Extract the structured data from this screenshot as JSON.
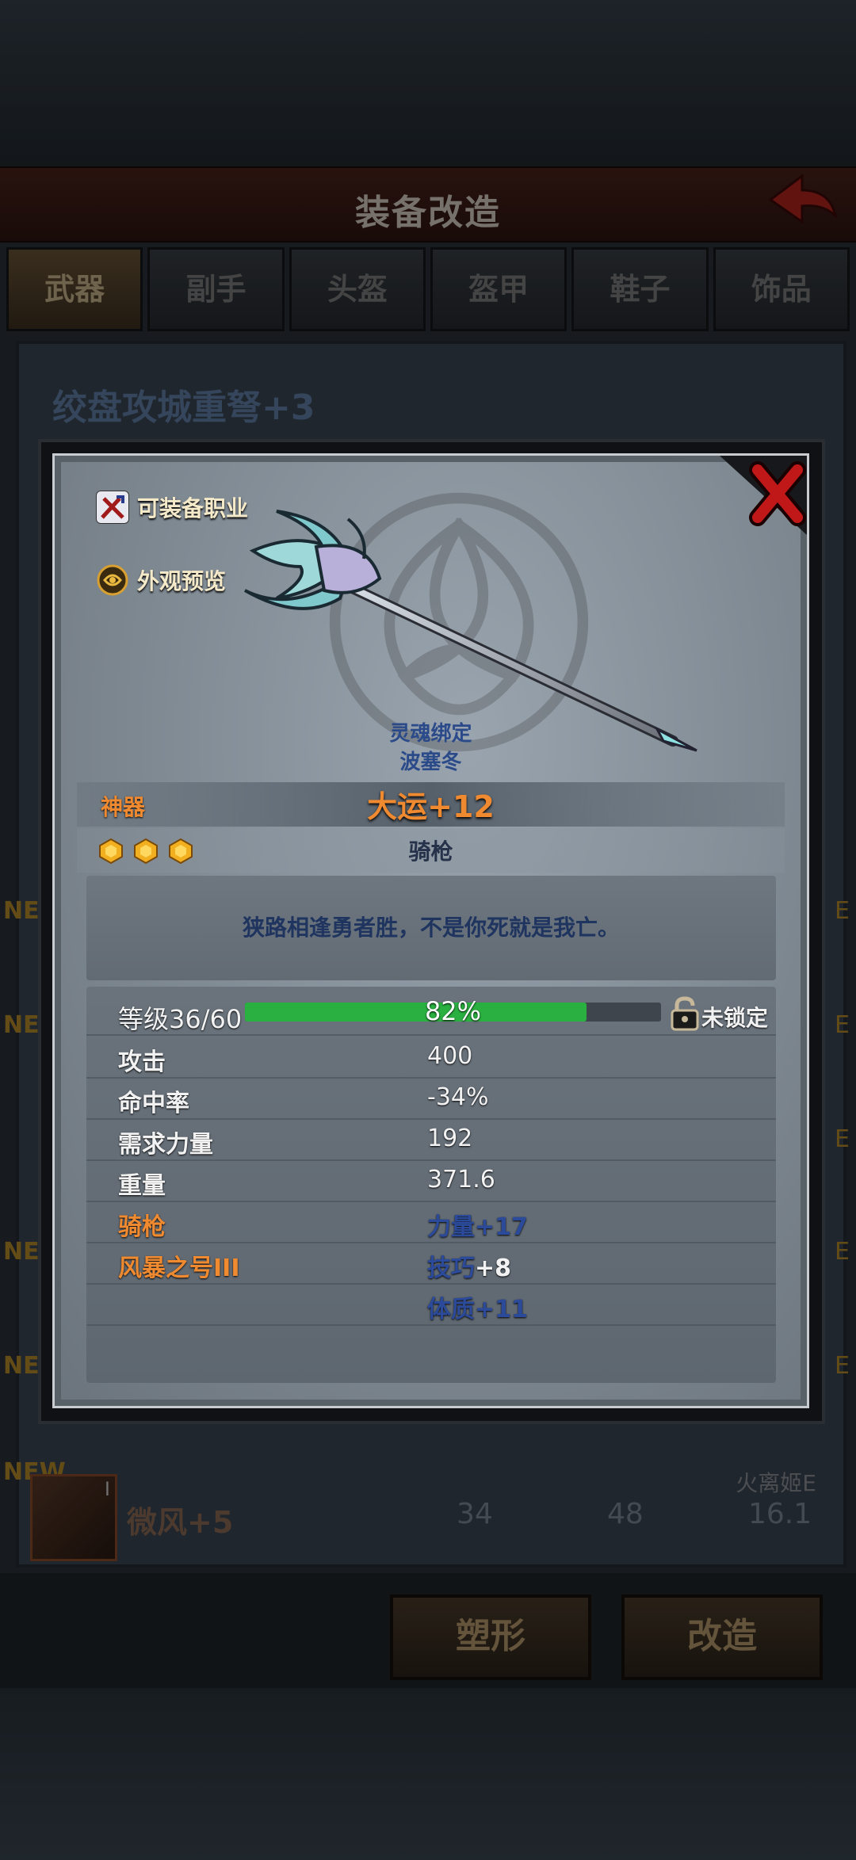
{
  "screen": {
    "title": "装备改造",
    "tabs": [
      "武器",
      "副手",
      "头盔",
      "盔甲",
      "鞋子",
      "饰品"
    ],
    "active_tab": 0,
    "background_item_name": "绞盘攻城重弩+3",
    "new_label": "NEW",
    "e_label": "E",
    "list_row": {
      "tier": "I",
      "name": "微风+5",
      "values": [
        "34",
        "48",
        "16.1"
      ],
      "owner": "火离姬E"
    },
    "buttons": {
      "reshape": "塑形",
      "modify": "改造"
    }
  },
  "modal": {
    "equip_class_label": "可装备职业",
    "appearance_label": "外观预览",
    "soul_bound": "灵魂绑定",
    "bound_to": "波塞冬",
    "rarity": "神器",
    "item_name": "大运+12",
    "item_type": "骑枪",
    "stars": 3,
    "quote": "狭路相逢勇者胜，不是你死就是我亡。",
    "level_label": "等级36/60",
    "xp_percent_text": "82%",
    "xp_fraction": 0.82,
    "lock_label": "未锁定",
    "stats": [
      {
        "label": "攻击",
        "value": "400"
      },
      {
        "label": "命中率",
        "value": "-34%"
      },
      {
        "label": "需求力量",
        "value": "192"
      },
      {
        "label": "重量",
        "value": "371.6"
      }
    ],
    "affixes": [
      {
        "label": "骑枪",
        "stat": "力量",
        "bonus": "+17"
      },
      {
        "label": "风暴之号III",
        "stat": "技巧",
        "bonus": "+8"
      },
      {
        "label": "",
        "stat": "体质",
        "bonus": "+11"
      }
    ],
    "colors": {
      "orange": "#f08a30",
      "blue": "#2b4a9a",
      "xp_green": "#2ab040"
    }
  }
}
